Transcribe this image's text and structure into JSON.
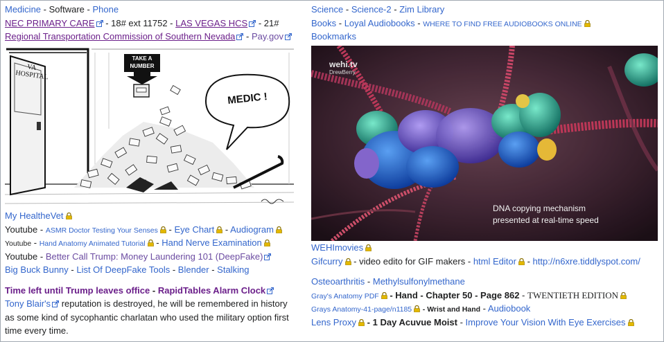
{
  "left": {
    "row1": {
      "medicine": "Medicine",
      "software": "Software",
      "phone": "Phone"
    },
    "row2": {
      "nec": "NEC PRIMARY CARE",
      "ext": "- 18# ext 11752 -",
      "lv": "LAS VEGAS HCS",
      "tail": "- 21#"
    },
    "row3": {
      "rtc": "Regional Transportation Commission of Southern Nevada",
      "pay": "Pay.gov"
    },
    "cartoon": {
      "door_label": "VA HOSPITAL",
      "sign": "TAKE A NUMBER",
      "bubble": "MEDIC !"
    },
    "row4": {
      "hv": "My HealtheVet"
    },
    "row5": {
      "yt": "Youtube",
      "asmr": "ASMR  Doctor Testing Your Senses",
      "eye": "Eye Chart",
      "audio": "Audiogram"
    },
    "row6": {
      "yt": "Youtube",
      "hand": "Hand Anatomy Animated Tutorial",
      "nerve": "Hand Nerve Examination"
    },
    "row7": {
      "yt": "Youtube",
      "bcs": "Better Call Trump: Money Laundering 101 (DeepFake)"
    },
    "row8": {
      "bbb": "Big Buck Bunny",
      "dft": "List Of DeepFake Tools",
      "blender": "Blender",
      "stalk": "Stalking"
    },
    "row9": {
      "time": "Time left until Trump leaves office",
      "rt": "RapidTables Alarm Clock"
    },
    "para": {
      "tb": "Tony Blair's",
      "text": "reputation is destroyed, he will be remembered in history as some kind of sycophantic charlatan who used the military option first time every time."
    }
  },
  "right": {
    "row1": {
      "sci": "Science",
      "sci2": "Science-2",
      "zim": "Zim Library"
    },
    "row2": {
      "books": "Books",
      "loyal": "Loyal Audiobooks",
      "where": "WHERE TO FIND FREE AUDIOBOOKS ONLINE"
    },
    "row3": {
      "bm": "Bookmarks"
    },
    "video": {
      "brand": "wehi.tv",
      "author": "DrewBerry",
      "caption1": "DNA copying mechanism",
      "caption2": "presented at real-time speed"
    },
    "row4": {
      "wehi": "WEHImovies"
    },
    "row5": {
      "gif": "Gifcurry",
      "gif_text": "- video edito for GIF makers -",
      "html": "html Editor",
      "url": "http://n6xre.tiddlyspot.com/"
    },
    "row6": {
      "osteo": "Osteoarthritis",
      "msm": "Methylsulfonylmethane"
    },
    "row7": {
      "gray": "Gray's Anatomy PDF",
      "hand": "Hand - Chapter 50 - Page 862",
      "ed": "TWENTIETH EDITION"
    },
    "row8": {
      "gray41": "Grays Anatomy-41-page/n1185",
      "wh": "Wrist and Hand",
      "ab": "Audiobook"
    },
    "row9": {
      "lens": "Lens Proxy",
      "acuvue": "1 Day Acuvue Moist",
      "improve": "Improve Your Vision With Eye Exercises"
    }
  },
  "colors": {
    "link": "#3366cc",
    "visited": "#6b4ba1",
    "text": "#202122",
    "border": "#a2a9b1",
    "lock": "#c8a200"
  }
}
